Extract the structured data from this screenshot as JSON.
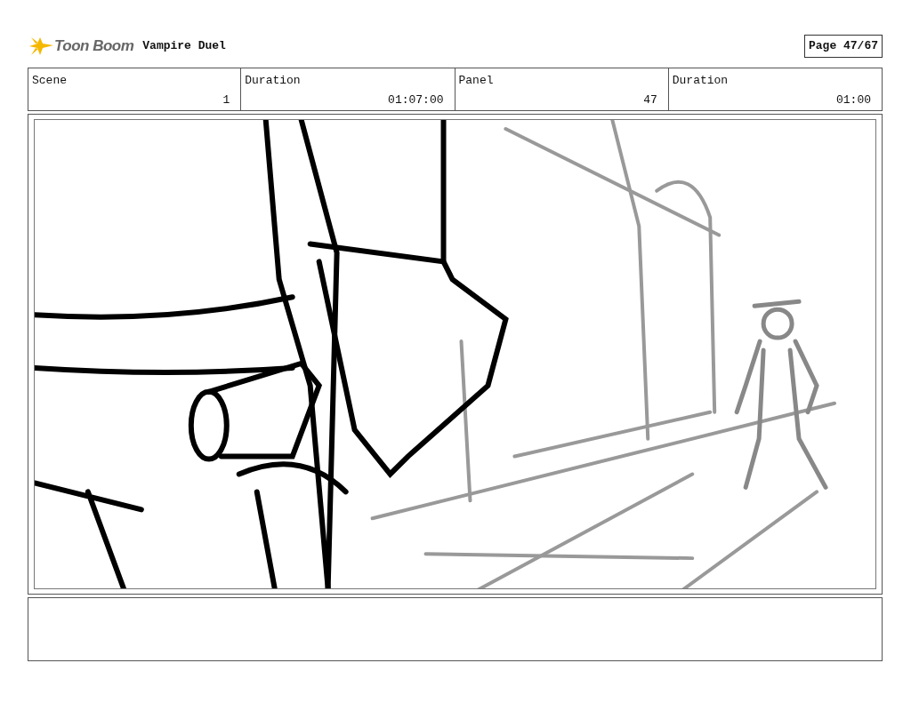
{
  "logo": {
    "text": "Toon Boom"
  },
  "title": "Vampire Duel",
  "page": "Page 47/67",
  "fields": [
    {
      "label": "Scene",
      "value": "1"
    },
    {
      "label": "Duration",
      "value": "01:07:00"
    },
    {
      "label": "Panel",
      "value": "47"
    },
    {
      "label": "Duration",
      "value": "01:00"
    }
  ],
  "panel": {
    "kind": "sketch"
  }
}
